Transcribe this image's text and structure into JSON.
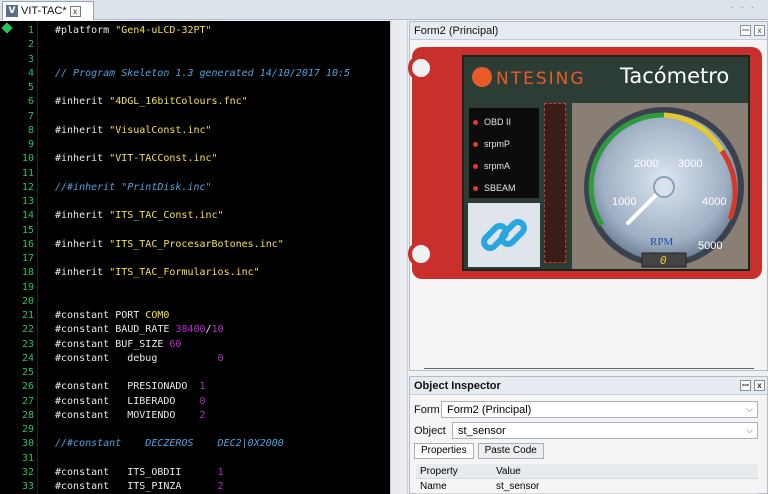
{
  "tab": {
    "label": "VIT-TAC*",
    "icon": "V",
    "close": "x"
  },
  "grip": "· · ·",
  "code_lines": [
    {
      "n": "1",
      "parts": [
        {
          "t": "#platform ",
          "c": "kw"
        },
        {
          "t": "\"Gen4-uLCD-32PT\"",
          "c": "str"
        }
      ]
    },
    {
      "n": "2",
      "parts": []
    },
    {
      "n": "3",
      "parts": []
    },
    {
      "n": "4",
      "parts": [
        {
          "t": "// Program Skeleton 1.3 generated 14/10/2017 10:5",
          "c": "cmt"
        }
      ]
    },
    {
      "n": "5",
      "parts": []
    },
    {
      "n": "6",
      "parts": [
        {
          "t": "#inherit ",
          "c": "kw"
        },
        {
          "t": "\"4DGL_16bitColours.fnc\"",
          "c": "str"
        }
      ]
    },
    {
      "n": "7",
      "parts": []
    },
    {
      "n": "8",
      "parts": [
        {
          "t": "#inherit ",
          "c": "kw"
        },
        {
          "t": "\"VisualConst.inc\"",
          "c": "str"
        }
      ]
    },
    {
      "n": "9",
      "parts": []
    },
    {
      "n": "10",
      "parts": [
        {
          "t": "#inherit ",
          "c": "kw"
        },
        {
          "t": "\"VIT-TACConst.inc\"",
          "c": "str"
        }
      ]
    },
    {
      "n": "11",
      "parts": []
    },
    {
      "n": "12",
      "parts": [
        {
          "t": "//#inherit \"PrintDisk.inc\"",
          "c": "cmt"
        }
      ]
    },
    {
      "n": "13",
      "parts": []
    },
    {
      "n": "14",
      "parts": [
        {
          "t": "#inherit ",
          "c": "kw"
        },
        {
          "t": "\"ITS_TAC_Const.inc\"",
          "c": "str"
        }
      ]
    },
    {
      "n": "15",
      "parts": []
    },
    {
      "n": "16",
      "parts": [
        {
          "t": "#inherit ",
          "c": "kw"
        },
        {
          "t": "\"ITS_TAC_ProcesarBotones.inc\"",
          "c": "str"
        }
      ]
    },
    {
      "n": "17",
      "parts": []
    },
    {
      "n": "18",
      "parts": [
        {
          "t": "#inherit ",
          "c": "kw"
        },
        {
          "t": "\"ITS_TAC_Formularios.inc\"",
          "c": "str"
        }
      ]
    },
    {
      "n": "19",
      "parts": []
    },
    {
      "n": "20",
      "parts": []
    },
    {
      "n": "21",
      "parts": [
        {
          "t": "#constant PORT ",
          "c": "kw"
        },
        {
          "t": "COM0",
          "c": "str"
        }
      ]
    },
    {
      "n": "22",
      "parts": [
        {
          "t": "#constant BAUD_RATE ",
          "c": "kw"
        },
        {
          "t": "38400",
          "c": "num"
        },
        {
          "t": "/",
          "c": "kw"
        },
        {
          "t": "10",
          "c": "num"
        }
      ]
    },
    {
      "n": "23",
      "parts": [
        {
          "t": "#constant BUF_SIZE ",
          "c": "kw"
        },
        {
          "t": "60",
          "c": "num"
        }
      ]
    },
    {
      "n": "24",
      "parts": [
        {
          "t": "#constant   debug          ",
          "c": "kw"
        },
        {
          "t": "0",
          "c": "num"
        }
      ]
    },
    {
      "n": "25",
      "parts": []
    },
    {
      "n": "26",
      "parts": [
        {
          "t": "#constant   PRESIONADO  ",
          "c": "kw"
        },
        {
          "t": "1",
          "c": "num"
        }
      ]
    },
    {
      "n": "27",
      "parts": [
        {
          "t": "#constant   LIBERADO    ",
          "c": "kw"
        },
        {
          "t": "0",
          "c": "num"
        }
      ]
    },
    {
      "n": "28",
      "parts": [
        {
          "t": "#constant   MOVIENDO    ",
          "c": "kw"
        },
        {
          "t": "2",
          "c": "num"
        }
      ]
    },
    {
      "n": "29",
      "parts": []
    },
    {
      "n": "30",
      "parts": [
        {
          "t": "//#constant    DECZEROS    DEC2|0X2000",
          "c": "cmt"
        }
      ]
    },
    {
      "n": "31",
      "parts": []
    },
    {
      "n": "32",
      "parts": [
        {
          "t": "#constant   ITS_OBDII      ",
          "c": "kw"
        },
        {
          "t": "1",
          "c": "num"
        }
      ]
    },
    {
      "n": "33",
      "parts": [
        {
          "t": "#constant   ITS_PINZA      ",
          "c": "kw"
        },
        {
          "t": "2",
          "c": "num"
        }
      ]
    }
  ],
  "form_panel": {
    "title": "Form2 (Principal)",
    "pin": "ꟷ",
    "close": "x"
  },
  "screen": {
    "brand": "ΝTESING",
    "title": "Tacómetro",
    "leds": [
      "OBD II",
      "srpmP",
      "srpmA",
      "SBEAM"
    ],
    "gauge": {
      "ticks": [
        "1000",
        "2000",
        "3000",
        "4000",
        "5000"
      ],
      "label": "RPM",
      "readout": "0",
      "value": 0
    }
  },
  "inspector": {
    "title": "Object Inspector",
    "form_label": "Form",
    "form_value": "Form2 (Principal)",
    "object_label": "Object",
    "object_value": "st_sensor",
    "tabs": [
      "Properties",
      "Paste Code"
    ],
    "table_headers": [
      "Property",
      "Value"
    ],
    "rows": [
      [
        "Name",
        "st_sensor"
      ]
    ]
  },
  "colors": {
    "accent": "#c9302c",
    "code_bg": "#000000",
    "line_number": "#22c55e",
    "string": "#f4e04d",
    "comment": "#4fa3e0",
    "number": "#c026d3"
  }
}
